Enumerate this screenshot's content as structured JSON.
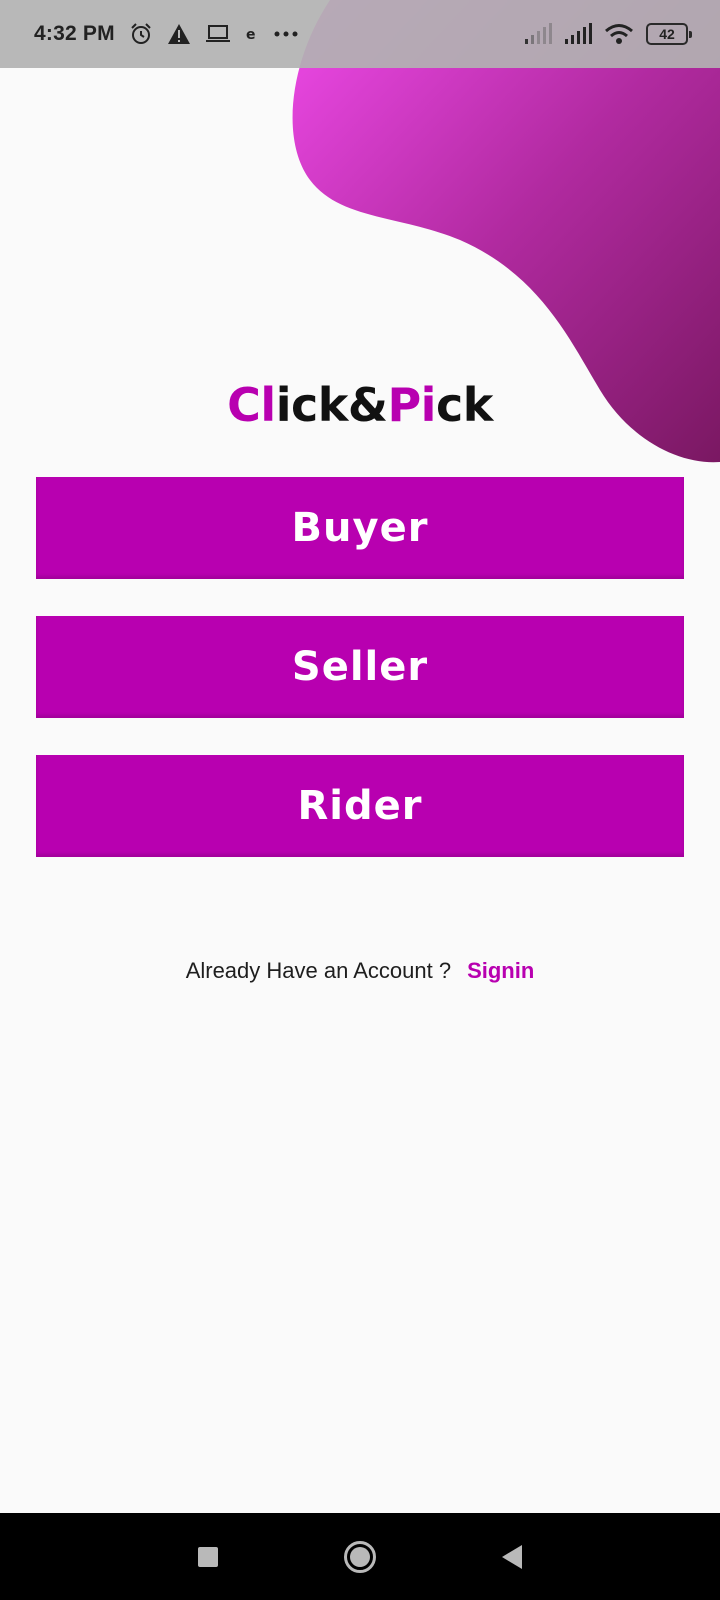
{
  "status_bar": {
    "time": "4:32 PM",
    "left_icons": [
      "alarm-icon",
      "warning-icon",
      "laptop-icon",
      "app-notification-icon",
      "more-dots-icon"
    ],
    "right_icons": [
      "signal-weak-icon",
      "signal-icon",
      "wifi-icon"
    ],
    "battery_level": "42"
  },
  "logo": {
    "part1": "Cl",
    "part2": "ick",
    "part3": "&",
    "part4": "Pi",
    "part5": "ck",
    "colors": {
      "accent": "#b800b0",
      "dark": "#111111"
    }
  },
  "roles": {
    "buyer_label": "Buyer",
    "seller_label": "Seller",
    "rider_label": "Rider"
  },
  "signin": {
    "question": "Already Have an Account ?",
    "link_label": "Signin"
  },
  "nav_bar": {
    "icons": [
      "recents-square-icon",
      "home-circle-icon",
      "back-triangle-icon"
    ]
  },
  "theme": {
    "accent": "#b800b0",
    "blob_gradient": [
      "#e54be4",
      "#b12aa0",
      "#7e1a68"
    ],
    "background": "#fafafa"
  }
}
